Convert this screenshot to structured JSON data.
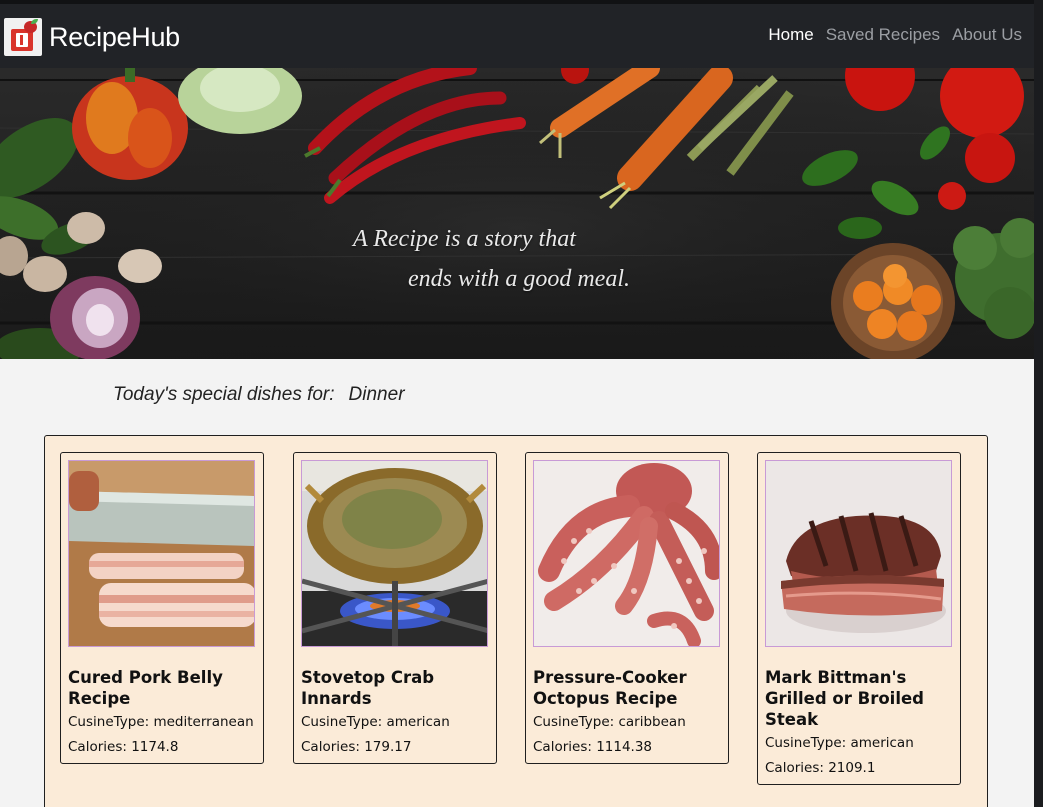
{
  "app": {
    "brand": "RecipeHub",
    "logo_icon": "recipe-book-icon"
  },
  "nav": {
    "items": [
      {
        "label": "Home",
        "active": true
      },
      {
        "label": "Saved Recipes",
        "active": false
      },
      {
        "label": "About Us",
        "active": false
      }
    ]
  },
  "hero": {
    "line1": "A Recipe is a story that",
    "line2": "ends with a good meal."
  },
  "special": {
    "label": "Today's special dishes for:",
    "meal": "Dinner"
  },
  "recipes": [
    {
      "title": "Cured Pork Belly Recipe",
      "cuisine": "CusineType: mediterranean",
      "calories": "Calories: 1174.8"
    },
    {
      "title": "Stovetop Crab Innards",
      "cuisine": "CusineType: american",
      "calories": "Calories: 179.17"
    },
    {
      "title": "Pressure-Cooker Octopus Recipe",
      "cuisine": "CusineType: caribbean",
      "calories": "Calories: 1114.38"
    },
    {
      "title": "Mark Bittman's Grilled or Broiled Steak",
      "cuisine": "CusineType: american",
      "calories": "Calories: 2109.1"
    }
  ],
  "colors": {
    "navbar": "#212327",
    "panel": "#fbebd8",
    "page": "#f3f3f3"
  }
}
